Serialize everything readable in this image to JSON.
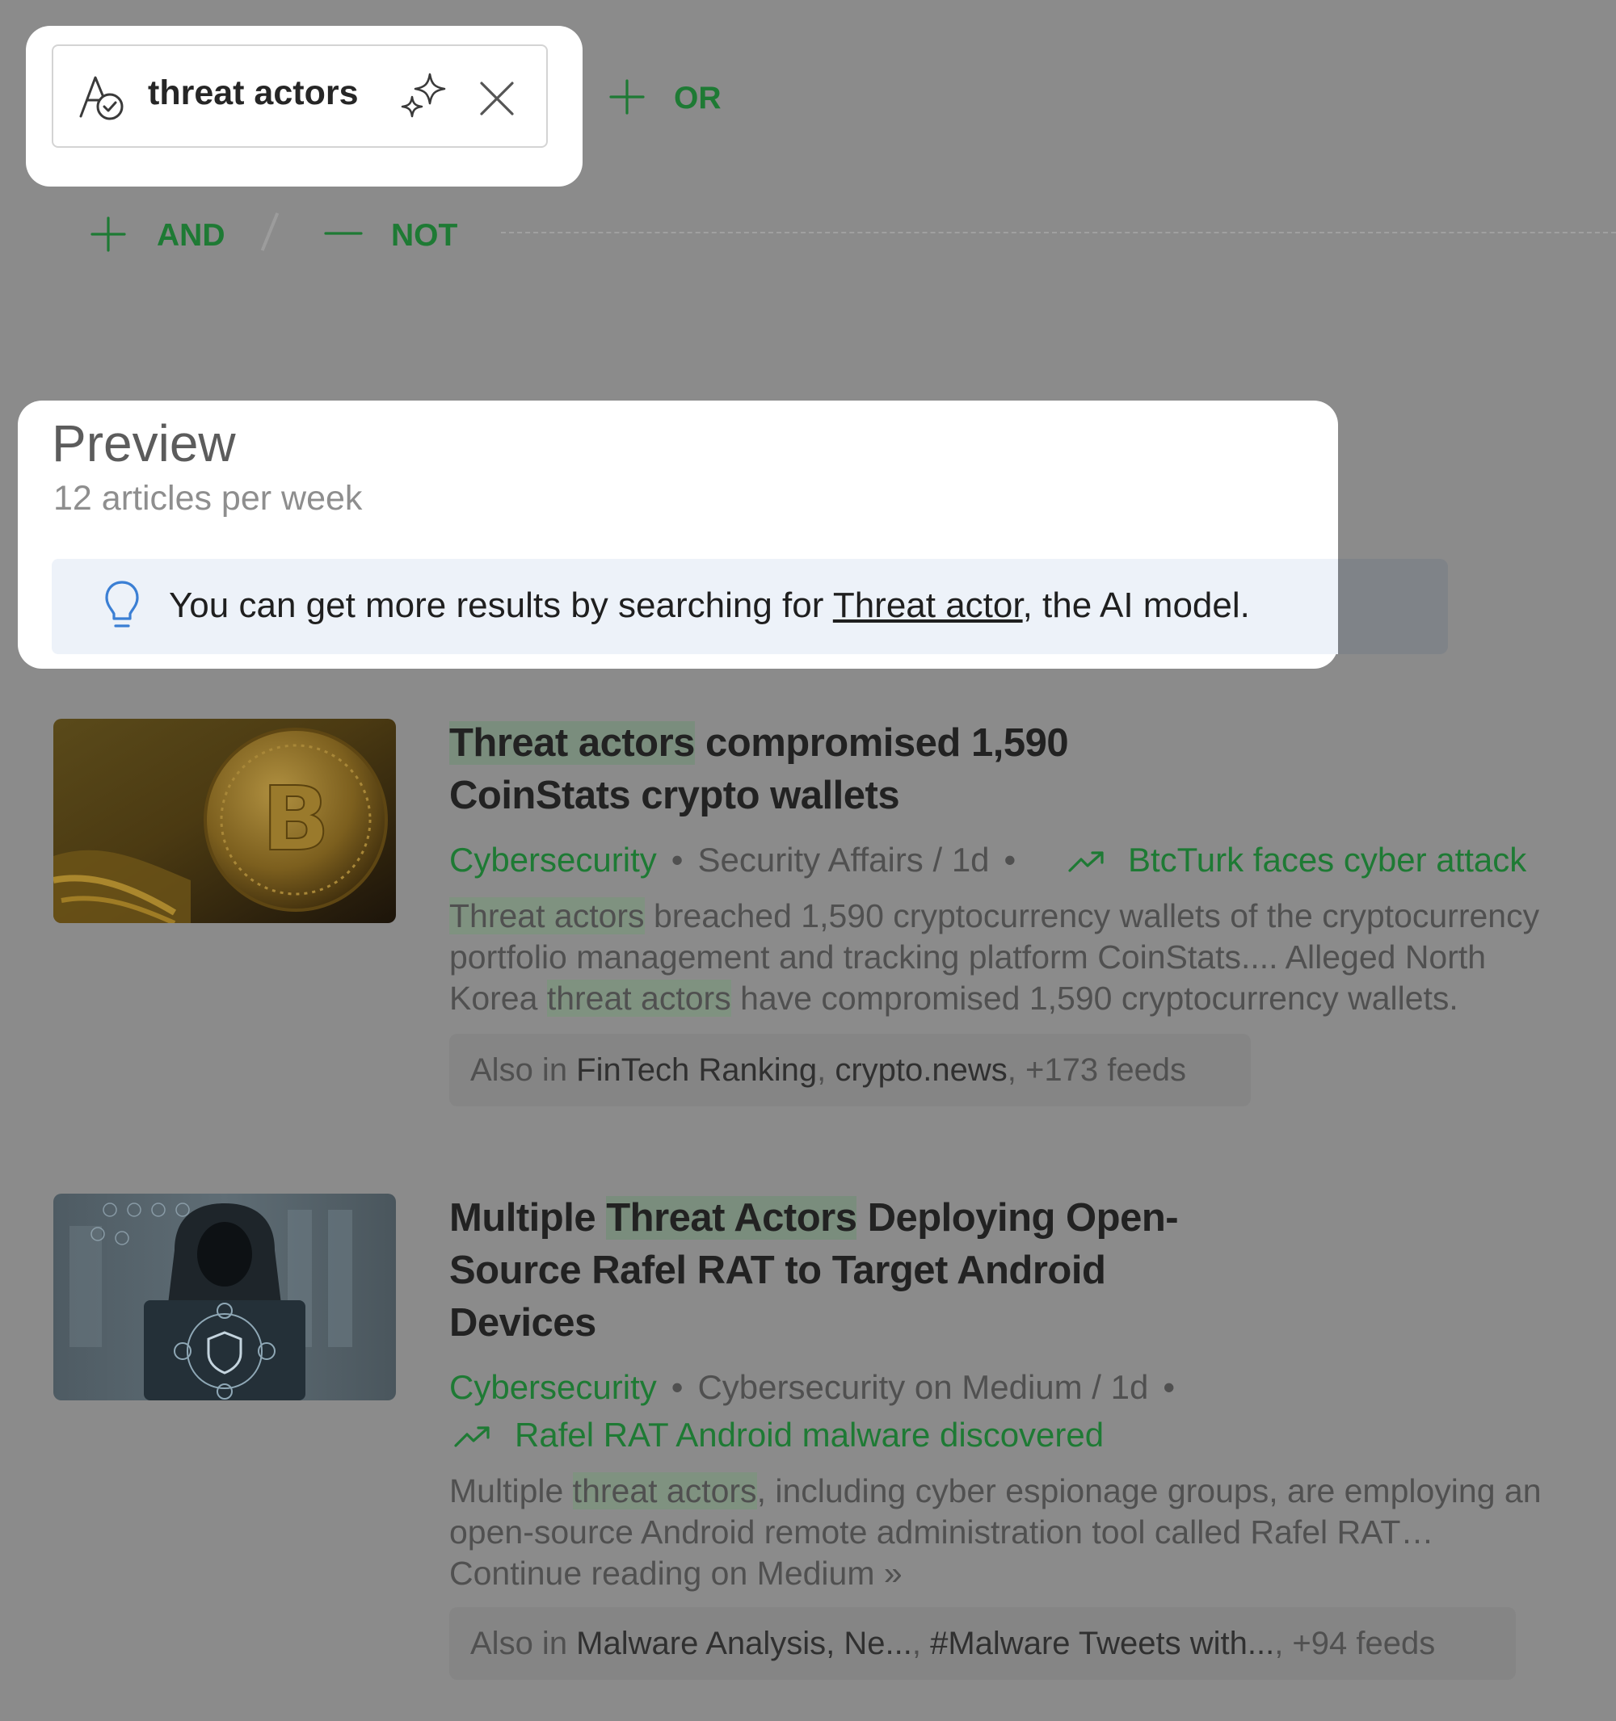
{
  "query": {
    "chip_text": "threat actors",
    "or_label": "OR",
    "and_label": "AND",
    "not_label": "NOT"
  },
  "preview": {
    "title": "Preview",
    "subtitle": "12 articles per week",
    "tip_before": "You can get more results by searching for ",
    "tip_link": "Threat actor",
    "tip_after": ", the AI model."
  },
  "articles": [
    {
      "title_hl": "Threat actors",
      "title_rest_1": " compromised 1,590",
      "title_rest_2": "CoinStats crypto wallets",
      "category": "Cybersecurity",
      "source": "Security Affairs / 1d",
      "trend": "BtcTurk faces cyber attack",
      "body_1_hl": "Threat actors",
      "body_1_rest": " breached 1,590 cryptocurrency wallets of the cryptocurrency",
      "body_2": "portfolio management and tracking platform CoinStats.... Alleged North",
      "body_3_pre": "Korea ",
      "body_3_hl": "threat actors",
      "body_3_post": " have compromised 1,590 cryptocurrency wallets.",
      "also_prefix": "Also in ",
      "also_feeds": "FinTech Ranking",
      "also_sep": ", ",
      "also_feeds_2": "crypto.news",
      "also_more": ", +173 feeds"
    },
    {
      "title_pre": "Multiple ",
      "title_hl": "Threat Actors",
      "title_rest_1": " Deploying Open-",
      "title_rest_2": "Source Rafel RAT to Target Android",
      "title_rest_3": "Devices",
      "category": "Cybersecurity",
      "source": "Cybersecurity on Medium / 1d",
      "trend": "Rafel RAT Android malware discovered",
      "body_1_pre": "Multiple ",
      "body_1_hl": "threat actors",
      "body_1_rest": ", including cyber espionage groups, are employing an",
      "body_2": "open-source Android remote administration tool called Rafel RAT…",
      "body_3": "Continue reading on Medium »",
      "also_prefix": "Also in ",
      "also_feeds": "Malware Analysis, Ne...",
      "also_sep": ", ",
      "also_feeds_2": "#Malware Tweets with...",
      "also_more": ", +94 feeds"
    }
  ],
  "icons": {
    "chip_icon": "ai-model-check-icon",
    "sparkle": "sparkle-icon",
    "close": "close-icon",
    "bulb": "lightbulb-icon",
    "trend": "trending-up-icon"
  },
  "colors": {
    "accent_green": "#1e7a34",
    "tip_background": "#edf2f9",
    "overlay": "#8b8b8b"
  }
}
